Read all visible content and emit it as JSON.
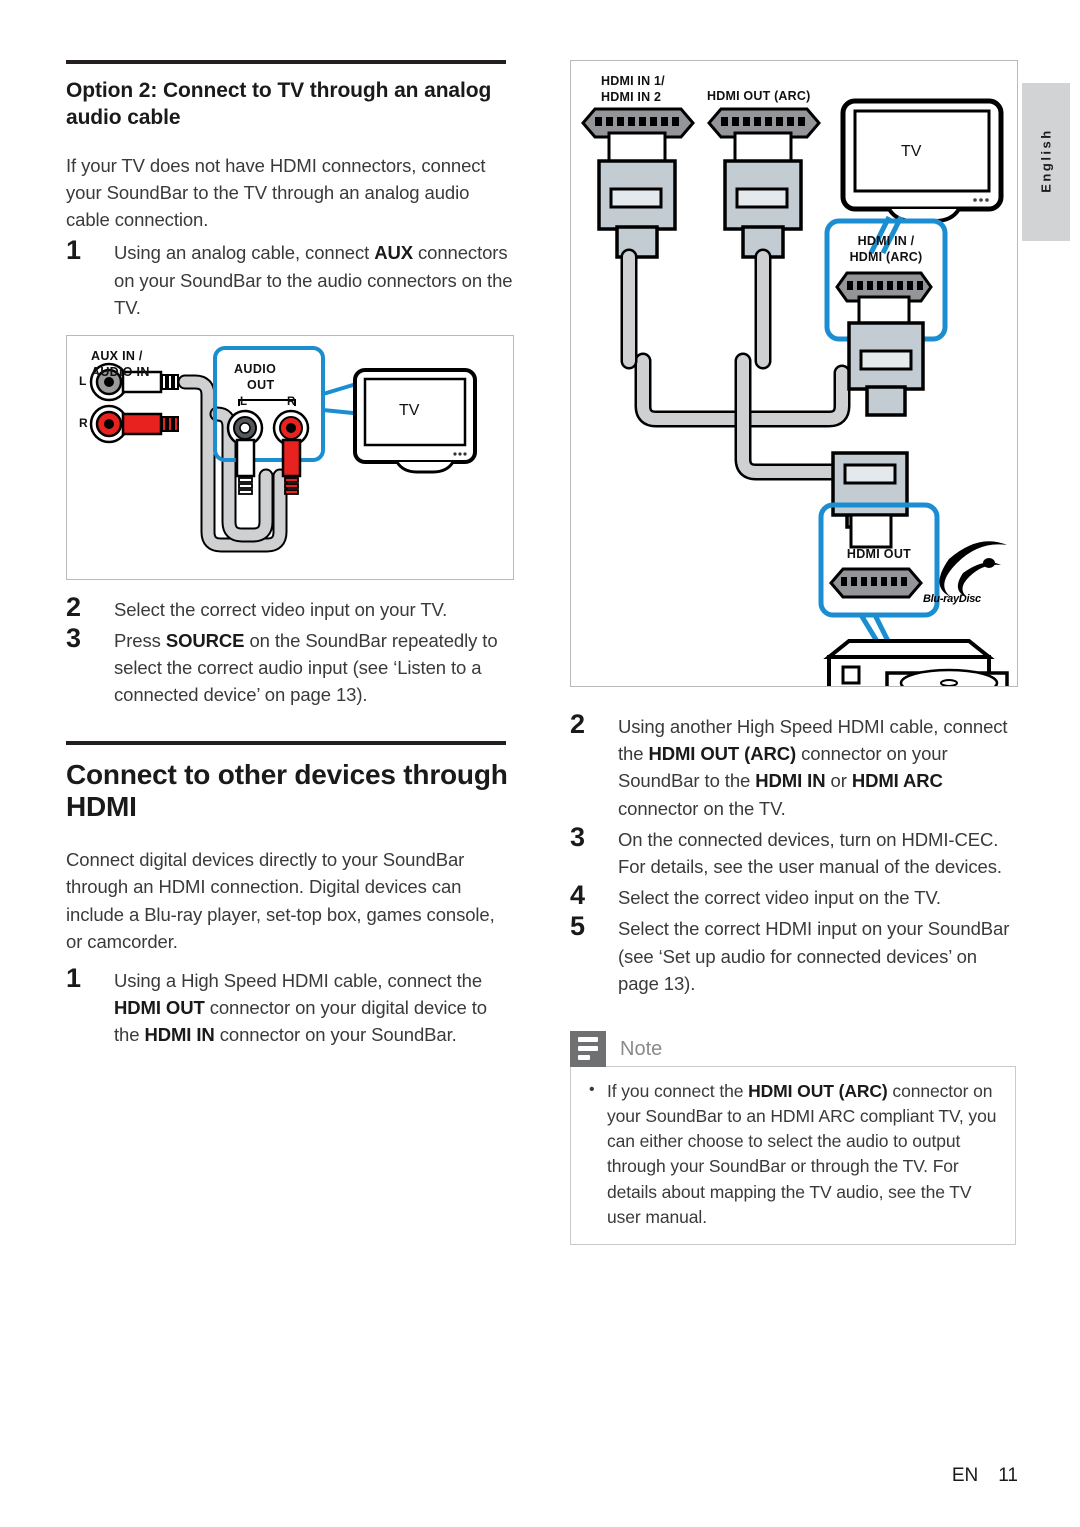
{
  "language_tab": {
    "label": "English"
  },
  "footer": {
    "locale": "EN",
    "page_number": "11"
  },
  "left_column": {
    "heading": "Option 2: Connect to TV through an analog audio cable",
    "intro": "If your TV does not have HDMI connectors, connect your SoundBar to the TV through an analog audio cable connection.",
    "steps": [
      {
        "num": "1",
        "text_before": "Using an analog cable, connect ",
        "bold": "AUX",
        "text_after": " connectors on your SoundBar to the audio connectors on the TV."
      },
      {
        "num": "2",
        "text_before": "Select the correct video input on your TV.",
        "bold": "",
        "text_after": ""
      },
      {
        "num": "3",
        "text_before": "Press ",
        "bold": "SOURCE",
        "text_after": " on the SoundBar repeatedly to select the correct audio input (see ‘Listen to a connected device’ on page 13)."
      }
    ],
    "section2": {
      "heading": "Connect to other devices through HDMI",
      "intro": "Connect digital devices directly to your SoundBar through an HDMI connection. Digital devices can include a Blu-ray player, set-top box, games console, or camcorder.",
      "steps": [
        {
          "num": "1",
          "parts": [
            "Using a High Speed HDMI cable, connect the ",
            "HDMI OUT",
            " connector on your digital device to the ",
            "HDMI IN",
            " connector on your SoundBar."
          ]
        }
      ]
    },
    "figure": {
      "caption_soundbar": "AUX IN /\nAUDIO IN",
      "label_soundbar_line1": "AUX IN /",
      "label_soundbar_line2": "AUDIO IN",
      "jack_left_label": "L",
      "jack_right_label": "R",
      "tv_audio_out_line1": "AUDIO",
      "tv_audio_out_line2": "OUT",
      "tv_audio_l": "L",
      "tv_audio_r": "R",
      "tv_label": "TV"
    }
  },
  "right_column": {
    "figure": {
      "hdmi_in_line1": "HDMI IN 1/",
      "hdmi_in_line2": "HDMI IN 2",
      "hdmi_out_arc": "HDMI OUT (ARC)",
      "tv_label": "TV",
      "tv_hdmi_line1": "HDMI IN /",
      "tv_hdmi_line2": "HDMI (ARC)",
      "device_hdmi_out": "HDMI OUT",
      "bluray_logo": "Blu-rayDisc"
    },
    "steps": [
      {
        "num": "2",
        "parts": [
          "Using another High Speed HDMI cable, connect the ",
          "HDMI OUT (ARC)",
          " connector on your SoundBar to the ",
          "HDMI IN",
          " or ",
          "HDMI ARC",
          " connector on the TV."
        ]
      },
      {
        "num": "3",
        "parts": [
          "On the connected devices, turn on HDMI-CEC. For details, see the user manual of the devices."
        ]
      },
      {
        "num": "4",
        "parts": [
          "Select the correct video input on the TV."
        ]
      },
      {
        "num": "5",
        "parts": [
          "Select the correct HDMI input on your SoundBar (see ‘Set up audio for connected devices’ on page 13)."
        ]
      }
    ],
    "note": {
      "title": "Note",
      "items": [
        {
          "parts": [
            "If you connect the ",
            "HDMI OUT (ARC)",
            " connector on your SoundBar to an HDMI ARC compliant TV, you can either choose to select the audio to output through your SoundBar or through the TV. For details about mapping the TV audio, see the TV user manual."
          ]
        }
      ]
    }
  },
  "colors": {
    "accent_blue": "#1b8ed1",
    "connector_red": "#e8231f",
    "cable_gray": "#cfd0d2",
    "connector_body": "#c3ccd3",
    "hdmi_shell": "#939598",
    "note_icon_bg": "#6f7072",
    "tab_bg": "#d2d3d5"
  }
}
